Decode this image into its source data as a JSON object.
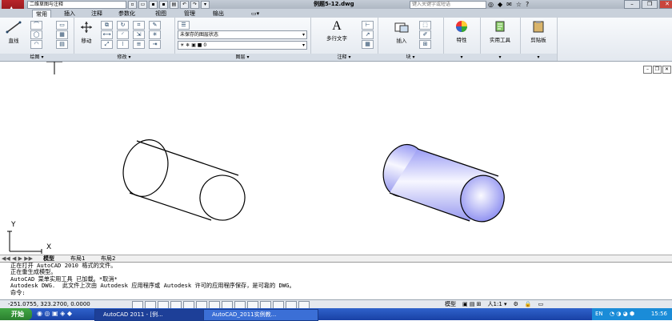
{
  "titlebar": {
    "workspace": "二维草图与注释",
    "document_title": "例题5-12.dwg",
    "search_placeholder": "键入关键字或短语"
  },
  "tabs": [
    "常用",
    "插入",
    "注释",
    "参数化",
    "视图",
    "管理",
    "输出"
  ],
  "ribbon": {
    "panels": [
      {
        "title": "绘图 ▾",
        "tools": [
          "直线"
        ]
      },
      {
        "title": "修改 ▾",
        "tools": [
          "移动"
        ]
      },
      {
        "title": "图层 ▾",
        "layer_state": "未保存的图层状态",
        "current_layer": "0"
      },
      {
        "title": "注释 ▾",
        "tools": [
          "多行文字"
        ]
      },
      {
        "title": "块 ▾",
        "tools": [
          "插入"
        ]
      },
      {
        "title": "",
        "tools": [
          "特性"
        ]
      },
      {
        "title": "",
        "tools": [
          "实用工具"
        ]
      },
      {
        "title": "",
        "tools": [
          "剪贴板"
        ]
      }
    ]
  },
  "ucs": {
    "y_label": "Y",
    "x_label": "X"
  },
  "layout_tabs": [
    "模型",
    "布局1",
    "布局2"
  ],
  "command_lines": [
    "正在打开 AutoCAD 2010 格式的文件。",
    "正在重生成模型。",
    "AutoCAD 菜单实用工具 已加载。*取消*",
    "Autodesk DWG.  此文件上次由 Autodesk 应用程序或 Autodesk 许可的应用程序保存，是可靠的 DWG。",
    "命令:"
  ],
  "statusbar": {
    "coords": "-251.0755, 323.2700, 0.0000",
    "space": "模型",
    "scale": "人1:1 ▾"
  },
  "taskbar": {
    "start": "开始",
    "tasks": [
      "AutoCAD 2011 - [例...",
      "AutoCAD_2011实例教..."
    ],
    "clock": "15:56",
    "lang": "EN"
  },
  "colors": {
    "ribbon_bg": "#e9edf2",
    "shaded_cylinder": "#8a8cf0",
    "taskbar": "#2553b8"
  }
}
